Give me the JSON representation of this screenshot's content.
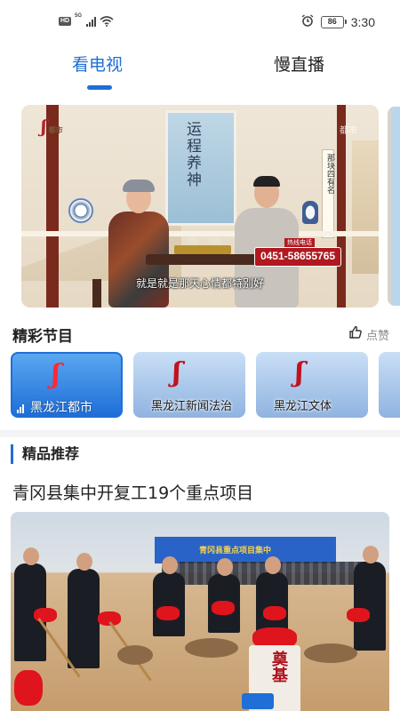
{
  "status_bar": {
    "hd_badge": "HD",
    "network_label": "5G",
    "battery": "86",
    "time": "3:30"
  },
  "tabs": [
    {
      "label": "看电视",
      "active": true
    },
    {
      "label": "慢直播",
      "active": false
    }
  ],
  "video": {
    "scroll_title": "运程养神",
    "side_scroll_text": "那块四有名",
    "phone_label": "热线电话",
    "phone": "0451-58655765",
    "subtitle": "就是就是那天心情都特别好",
    "corner_mark": "都市"
  },
  "featured": {
    "title": "精彩节目",
    "like_label": "点赞",
    "channels": [
      {
        "name": "黑龙江都市",
        "selected": true
      },
      {
        "name": "黑龙江新闻法治",
        "selected": false
      },
      {
        "name": "黑龙江文体",
        "selected": false
      }
    ]
  },
  "recommended": {
    "title": "精品推荐",
    "news_title": "青冈县集中开复工19个重点项目",
    "banner_text": "青冈县重点项目集中",
    "stone_text": "奠基"
  },
  "colors": {
    "accent": "#1f6fd6",
    "logo_red": "#c1121f"
  }
}
